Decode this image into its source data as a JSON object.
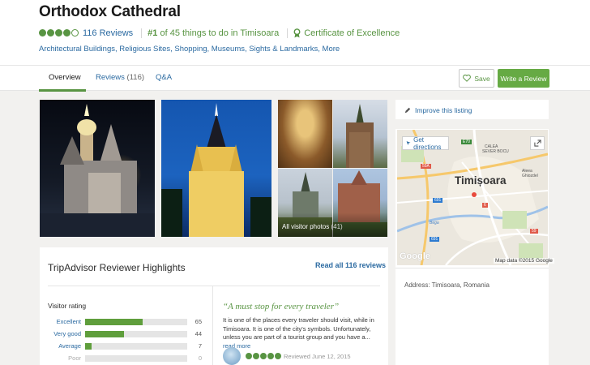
{
  "header": {
    "title": "Orthodox Cathedral",
    "rating_bubbles": 4,
    "reviews_link": "116 Reviews",
    "rank_number": "#1",
    "rank_text": " of 45 things to do in Timisoara",
    "certificate": "Certificate of Excellence",
    "categories": "Architectural Buildings, Religious Sites, Shopping, Museums, Sights & Landmarks, More"
  },
  "tabs": {
    "overview": "Overview",
    "reviews": "Reviews",
    "reviews_count": "(116)",
    "qa": "Q&A",
    "save": "Save",
    "write_review": "Write a Review"
  },
  "photos": {
    "all_visitor_photos": "All visitor photos",
    "count": "(41)"
  },
  "side": {
    "improve": "Improve this listing",
    "get_directions": "Get directions",
    "city": "Timișoara",
    "map_credit": "Map data ©2015 Google",
    "google": "Google",
    "address": "Address: Timisoara, Romania"
  },
  "map_labels": {
    "calea_1": "CALEA",
    "calea_2": "SEVER BOCU",
    "aleea": "Aleea Ghiozdel",
    "road_1": "59A",
    "road_2": "691",
    "road_3": "6",
    "road_4": "E70",
    "road_5": "691",
    "road_6": "59",
    "bega": "Bega"
  },
  "highlights": {
    "title": "TripAdvisor Reviewer Highlights",
    "read_all": "Read all 116 reviews",
    "visitor_rating": "Visitor rating",
    "ratings": [
      {
        "label": "Excellent",
        "count": "65",
        "fraction": 0.56
      },
      {
        "label": "Very good",
        "count": "44",
        "fraction": 0.38
      },
      {
        "label": "Average",
        "count": "7",
        "fraction": 0.06
      },
      {
        "label": "Poor",
        "count": "0",
        "fraction": 0
      }
    ],
    "quote": "“A must stop for every traveler”",
    "review_text": "It is one of the places every traveler should visit, while in Timisoara. It is one of the city's symbols. Unfortunately, unless you are part of a tourist group and you have a...",
    "read_more": "read more",
    "review_bubbles": 5,
    "reviewed_date": "Reviewed June 12, 2015"
  },
  "colors": {
    "accent_green": "#589442",
    "link_blue": "#2b6aa1",
    "button_green": "#66aa44"
  }
}
